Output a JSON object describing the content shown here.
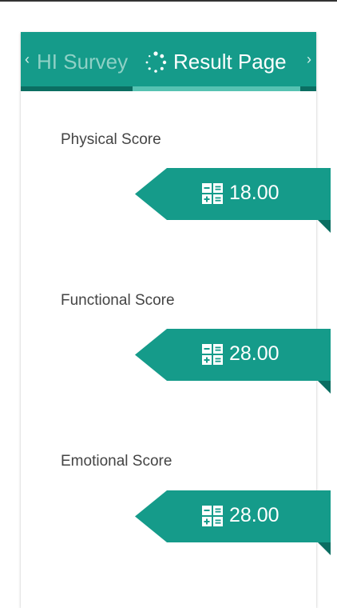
{
  "tabs": {
    "prev_label": "HI Survey",
    "current_label": "Result Page",
    "left_chevron": "‹",
    "right_chevron": "›"
  },
  "scores": [
    {
      "label": "Physical Score",
      "value": "18.00"
    },
    {
      "label": "Functional Score",
      "value": "28.00"
    },
    {
      "label": "Emotional Score",
      "value": "28.00"
    }
  ],
  "colors": {
    "primary": "#159b8a",
    "primary_dark": "#0b6e62",
    "indicator": "#56c2b2"
  },
  "icons": {
    "current_tab": "spinner-icon",
    "score": "calculator-icon"
  }
}
